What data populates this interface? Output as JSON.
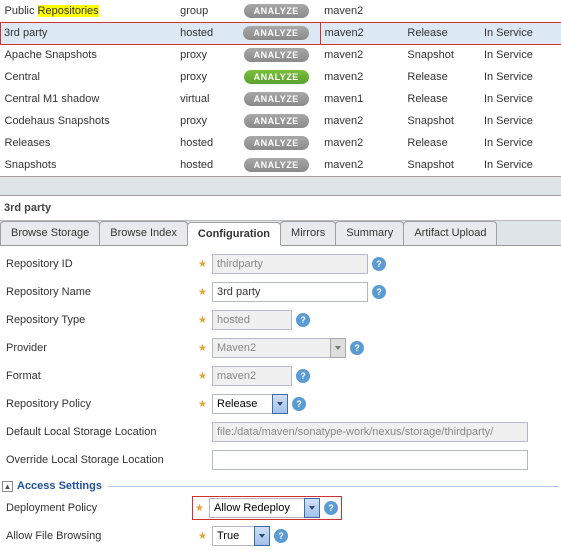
{
  "repos": [
    {
      "name_prefix": "Public ",
      "name_hl": "Repositories",
      "type": "group",
      "btn": "ANALYZE",
      "btn_style": "gray",
      "fmt": "maven2",
      "policy": "",
      "status": ""
    },
    {
      "name": "3rd party",
      "type": "hosted",
      "btn": "ANALYZE",
      "btn_style": "gray",
      "fmt": "maven2",
      "policy": "Release",
      "status": "In Service",
      "highlighted": true
    },
    {
      "name": "Apache Snapshots",
      "type": "proxy",
      "btn": "ANALYZE",
      "btn_style": "gray",
      "fmt": "maven2",
      "policy": "Snapshot",
      "status": "In Service"
    },
    {
      "name": "Central",
      "type": "proxy",
      "btn": "ANALYZE",
      "btn_style": "green",
      "fmt": "maven2",
      "policy": "Release",
      "status": "In Service"
    },
    {
      "name": "Central M1 shadow",
      "type": "virtual",
      "btn": "ANALYZE",
      "btn_style": "gray",
      "fmt": "maven1",
      "policy": "Release",
      "status": "In Service"
    },
    {
      "name": "Codehaus Snapshots",
      "type": "proxy",
      "btn": "ANALYZE",
      "btn_style": "gray",
      "fmt": "maven2",
      "policy": "Snapshot",
      "status": "In Service"
    },
    {
      "name": "Releases",
      "type": "hosted",
      "btn": "ANALYZE",
      "btn_style": "gray",
      "fmt": "maven2",
      "policy": "Release",
      "status": "In Service"
    },
    {
      "name": "Snapshots",
      "type": "hosted",
      "btn": "ANALYZE",
      "btn_style": "gray",
      "fmt": "maven2",
      "policy": "Snapshot",
      "status": "In Service"
    }
  ],
  "detail": {
    "title": "3rd party",
    "tabs": [
      "Browse Storage",
      "Browse Index",
      "Configuration",
      "Mirrors",
      "Summary",
      "Artifact Upload"
    ],
    "active_tab": 2,
    "fields": {
      "repo_id_label": "Repository ID",
      "repo_id_value": "thirdparty",
      "repo_name_label": "Repository Name",
      "repo_name_value": "3rd party",
      "repo_type_label": "Repository Type",
      "repo_type_value": "hosted",
      "provider_label": "Provider",
      "provider_value": "Maven2",
      "format_label": "Format",
      "format_value": "maven2",
      "policy_label": "Repository Policy",
      "policy_value": "Release",
      "default_loc_label": "Default Local Storage Location",
      "default_loc_value": "file:/data/maven/sonatype-work/nexus/storage/thirdparty/",
      "override_loc_label": "Override Local Storage Location",
      "override_loc_value": "",
      "access_legend": "Access Settings",
      "deploy_label": "Deployment Policy",
      "deploy_value": "Allow Redeploy",
      "browse_label": "Allow File Browsing",
      "browse_value": "True"
    }
  }
}
